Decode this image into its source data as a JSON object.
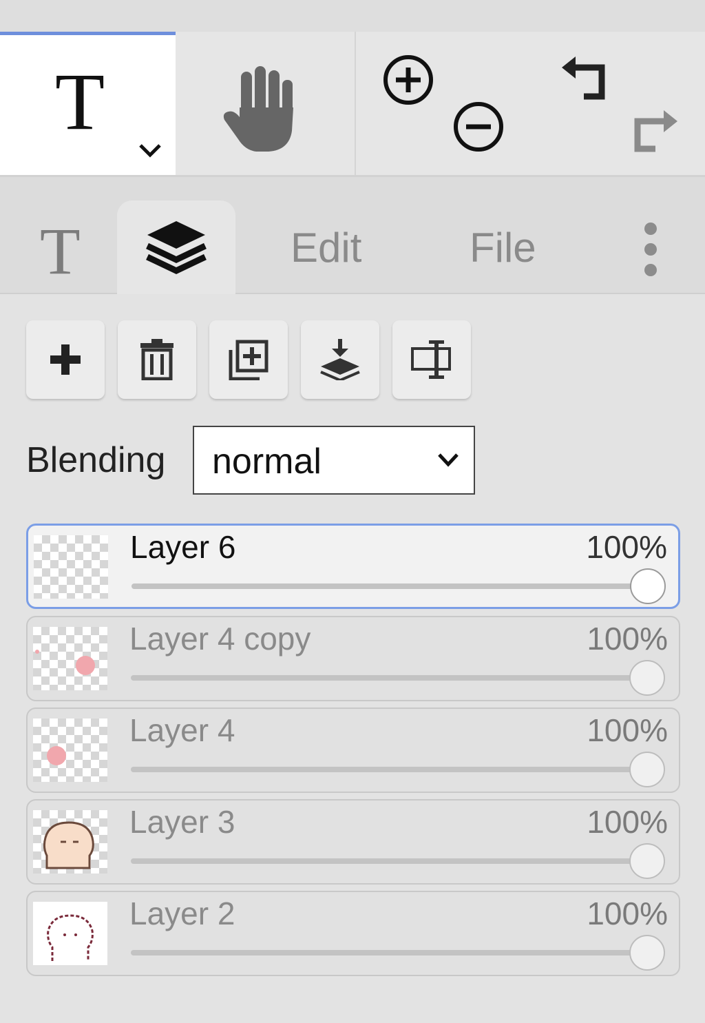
{
  "toolbar": {
    "text_tool_glyph": "T",
    "icons": [
      "text-tool-icon",
      "chevron-down-icon",
      "hand-icon",
      "zoom-in-icon",
      "zoom-out-icon",
      "undo-icon",
      "redo-icon"
    ],
    "accent_color": "#6e8fdc"
  },
  "tabs": {
    "type_glyph": "T",
    "layers_icon": "layers-icon",
    "edit_label": "Edit",
    "file_label": "File",
    "more_icon": "more-vertical-icon",
    "selected": "layers"
  },
  "layer_actions": [
    "add-layer-icon",
    "delete-layer-icon",
    "duplicate-layer-icon",
    "merge-down-icon",
    "rename-layer-icon"
  ],
  "blending": {
    "label": "Blending",
    "value": "normal"
  },
  "layers": [
    {
      "name": "Layer 6",
      "opacity_label": "100%",
      "opacity": 1.0,
      "selected": true
    },
    {
      "name": "Layer 4 copy",
      "opacity_label": "100%",
      "opacity": 1.0,
      "selected": false
    },
    {
      "name": "Layer 4",
      "opacity_label": "100%",
      "opacity": 1.0,
      "selected": false
    },
    {
      "name": "Layer 3",
      "opacity_label": "100%",
      "opacity": 1.0,
      "selected": false
    },
    {
      "name": "Layer 2",
      "opacity_label": "100%",
      "opacity": 1.0,
      "selected": false
    }
  ]
}
